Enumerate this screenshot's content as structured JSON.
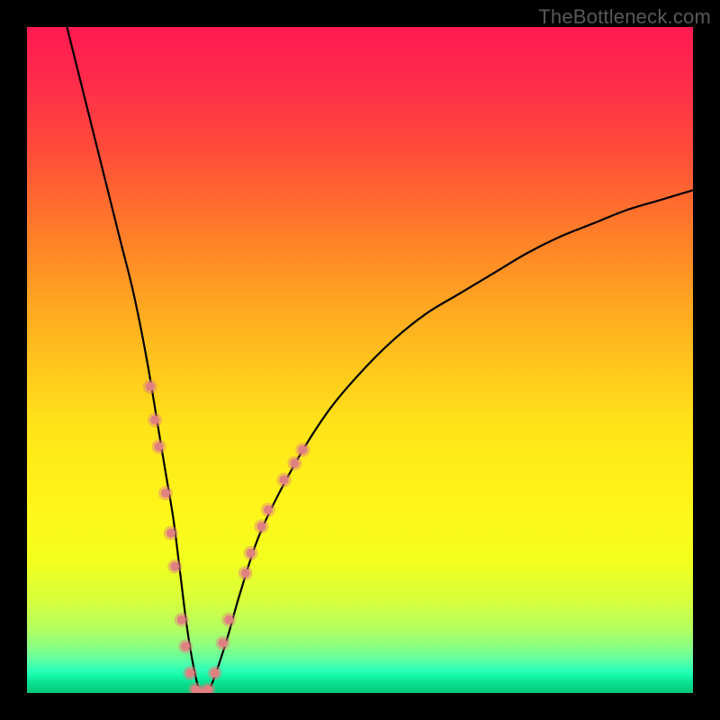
{
  "watermark": {
    "text": "TheBottleneck.com"
  },
  "chart_data": {
    "type": "line",
    "title": "",
    "xlabel": "",
    "ylabel": "",
    "xlim": [
      0,
      100
    ],
    "ylim": [
      0,
      100
    ],
    "grid": false,
    "legend": null,
    "background_gradient_stops": [
      {
        "offset": 0.0,
        "color": "#ff1a52"
      },
      {
        "offset": 0.08,
        "color": "#ff2b4b"
      },
      {
        "offset": 0.18,
        "color": "#ff4a3a"
      },
      {
        "offset": 0.3,
        "color": "#ff7a2a"
      },
      {
        "offset": 0.45,
        "color": "#ffb21f"
      },
      {
        "offset": 0.6,
        "color": "#ffe419"
      },
      {
        "offset": 0.72,
        "color": "#fff51a"
      },
      {
        "offset": 0.8,
        "color": "#f3ff1f"
      },
      {
        "offset": 0.86,
        "color": "#d8ff3a"
      },
      {
        "offset": 0.9,
        "color": "#b8ff5d"
      },
      {
        "offset": 0.93,
        "color": "#8cff82"
      },
      {
        "offset": 0.95,
        "color": "#5effa0"
      },
      {
        "offset": 0.965,
        "color": "#2fffb8"
      },
      {
        "offset": 0.975,
        "color": "#13f7a8"
      },
      {
        "offset": 0.985,
        "color": "#0adf8f"
      },
      {
        "offset": 1.0,
        "color": "#06c878"
      }
    ],
    "series": [
      {
        "name": "bottleneck-curve",
        "stroke": "#000000",
        "stroke_width": 2.2,
        "x": [
          6,
          8,
          10,
          12,
          14,
          16,
          18,
          20,
          21,
          22,
          23,
          24,
          25,
          26,
          27,
          28,
          30,
          32,
          35,
          40,
          45,
          50,
          55,
          60,
          65,
          70,
          75,
          80,
          85,
          90,
          95,
          100
        ],
        "y": [
          100,
          92,
          84,
          76,
          68,
          60,
          50,
          38,
          32,
          26,
          18,
          10,
          4,
          0,
          0,
          2,
          8,
          15,
          24,
          34,
          42,
          48,
          53,
          57,
          60,
          63,
          66,
          68.5,
          70.5,
          72.5,
          74,
          75.5
        ]
      }
    ],
    "markers": {
      "color": "#e08080",
      "radius_outer": 8,
      "radius_inner": 5,
      "points": [
        {
          "x": 18.5,
          "y": 46
        },
        {
          "x": 19.2,
          "y": 41
        },
        {
          "x": 19.8,
          "y": 37
        },
        {
          "x": 20.8,
          "y": 30
        },
        {
          "x": 21.6,
          "y": 24
        },
        {
          "x": 22.2,
          "y": 19
        },
        {
          "x": 23.2,
          "y": 11
        },
        {
          "x": 23.8,
          "y": 7
        },
        {
          "x": 24.5,
          "y": 3
        },
        {
          "x": 25.3,
          "y": 0.5
        },
        {
          "x": 26.2,
          "y": 0
        },
        {
          "x": 27.2,
          "y": 0.5
        },
        {
          "x": 28.2,
          "y": 3
        },
        {
          "x": 29.4,
          "y": 7.5
        },
        {
          "x": 30.3,
          "y": 11
        },
        {
          "x": 32.8,
          "y": 18
        },
        {
          "x": 33.6,
          "y": 21
        },
        {
          "x": 35.2,
          "y": 25
        },
        {
          "x": 36.2,
          "y": 27.5
        },
        {
          "x": 38.6,
          "y": 32
        },
        {
          "x": 40.2,
          "y": 34.5
        },
        {
          "x": 41.4,
          "y": 36.5
        }
      ]
    }
  }
}
